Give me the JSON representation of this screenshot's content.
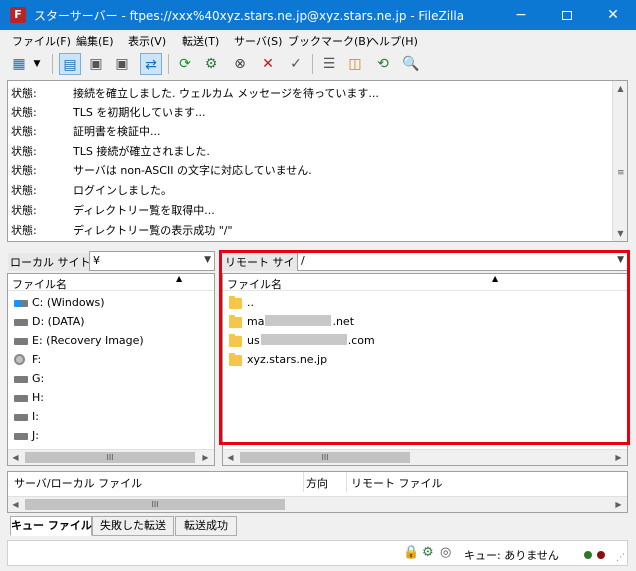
{
  "window": {
    "app_icon_letter": "F",
    "title": "スターサーバー - ftpes://xxx%40xyz.stars.ne.jp@xyz.stars.ne.jp - FileZilla",
    "minimize": "−",
    "close": "✕"
  },
  "menu": [
    "ファイル(F)",
    "編集(E)",
    "表示(V)",
    "転送(T)",
    "サーバ(S)",
    "ブックマーク(B)",
    "ヘルプ(H)"
  ],
  "toolbar": {
    "icons": [
      "site-manager-icon",
      "dropdown-arrow-icon",
      "toggle-log-icon",
      "toggle-local-tree-icon",
      "toggle-remote-tree-icon",
      "toggle-queue-icon",
      "refresh-icon",
      "process-queue-icon",
      "cancel-icon",
      "disconnect-icon",
      "reconnect-icon",
      "filter-icon",
      "compare-icon",
      "sync-browse-icon",
      "search-icon"
    ]
  },
  "log": {
    "label": "状態:",
    "messages": [
      "接続を確立しました. ウェルカム メッセージを待っています...",
      "TLS を初期化しています...",
      "証明書を検証中...",
      "TLS 接続が確立されました.",
      "サーバは non-ASCII の文字に対応していません.",
      "ログインしました。",
      "ディレクトリー覧を取得中...",
      "ディレクトリー覧の表示成功 \"/\""
    ]
  },
  "local": {
    "site_label": "ローカル サイト:",
    "path": "¥",
    "column": "ファイル名",
    "drives": [
      {
        "label": "C: (Windows)",
        "kind": "windows-drive-icon"
      },
      {
        "label": "D: (DATA)",
        "kind": "hard-drive-icon"
      },
      {
        "label": "E: (Recovery Image)",
        "kind": "hard-drive-icon"
      },
      {
        "label": "F:",
        "kind": "optical-drive-icon"
      },
      {
        "label": "G:",
        "kind": "hard-drive-icon"
      },
      {
        "label": "H:",
        "kind": "hard-drive-icon"
      },
      {
        "label": "I:",
        "kind": "hard-drive-icon"
      },
      {
        "label": "J:",
        "kind": "hard-drive-icon"
      }
    ]
  },
  "remote": {
    "site_label": "リモート サイト:",
    "path": "/",
    "column": "ファイル名",
    "items": [
      {
        "prefix": "..",
        "suffix": ""
      },
      {
        "prefix": "ma",
        "suffix": ".net"
      },
      {
        "prefix": "us",
        "suffix": ".com"
      },
      {
        "prefix": "xyz.stars.ne.jp",
        "suffix": ""
      }
    ]
  },
  "scroll_grip": "III",
  "queue": {
    "col_server_local": "サーバ/ローカル ファイル",
    "col_direction": "方向",
    "col_remote": "リモート ファイル"
  },
  "tabs": [
    "キュー ファイル",
    "失敗した転送",
    "転送成功"
  ],
  "status": {
    "queue_text": "キュー: ありません"
  },
  "colors": {
    "titlebar": "#0c78d4",
    "highlight": "#e60012"
  }
}
